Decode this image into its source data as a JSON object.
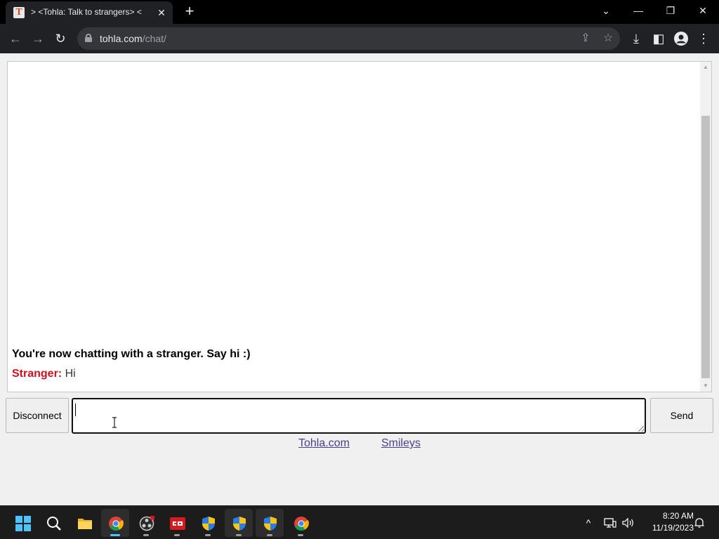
{
  "browser": {
    "tab": {
      "title": "> <Tohla: Talk to strangers> <",
      "favicon_letter": "T",
      "close_glyph": "✕"
    },
    "new_tab_glyph": "+",
    "window_controls": {
      "tab_search": "⌄",
      "minimize": "—",
      "restore": "❐",
      "close": "✕"
    },
    "toolbar": {
      "back": "←",
      "forward": "→",
      "reload": "↻",
      "url_host": "tohla.com",
      "url_path": "/chat/",
      "share": "⇪",
      "bookmark": "☆",
      "download": "⤓",
      "side_panel": "◧",
      "menu": "⋮"
    }
  },
  "chat": {
    "status_message": "You're now chatting with a stranger. Say hi :)",
    "messages": [
      {
        "sender": "Stranger:",
        "text": "Hi"
      }
    ],
    "scroll_up": "▲",
    "scroll_down": "▼",
    "disconnect_label": "Disconnect",
    "send_label": "Send",
    "input_value": "",
    "footer_links": [
      "Tohla.com",
      "Smileys"
    ]
  },
  "taskbar": {
    "apps": [
      "start-icon",
      "search-icon",
      "file-explorer-icon",
      "chrome-icon",
      "obs-icon",
      "app-icon",
      "shield-icon",
      "shield-icon",
      "shield-icon",
      "chrome-icon"
    ],
    "tray_chevron": "^",
    "time": "8:20 AM",
    "date": "11/19/2023"
  }
}
